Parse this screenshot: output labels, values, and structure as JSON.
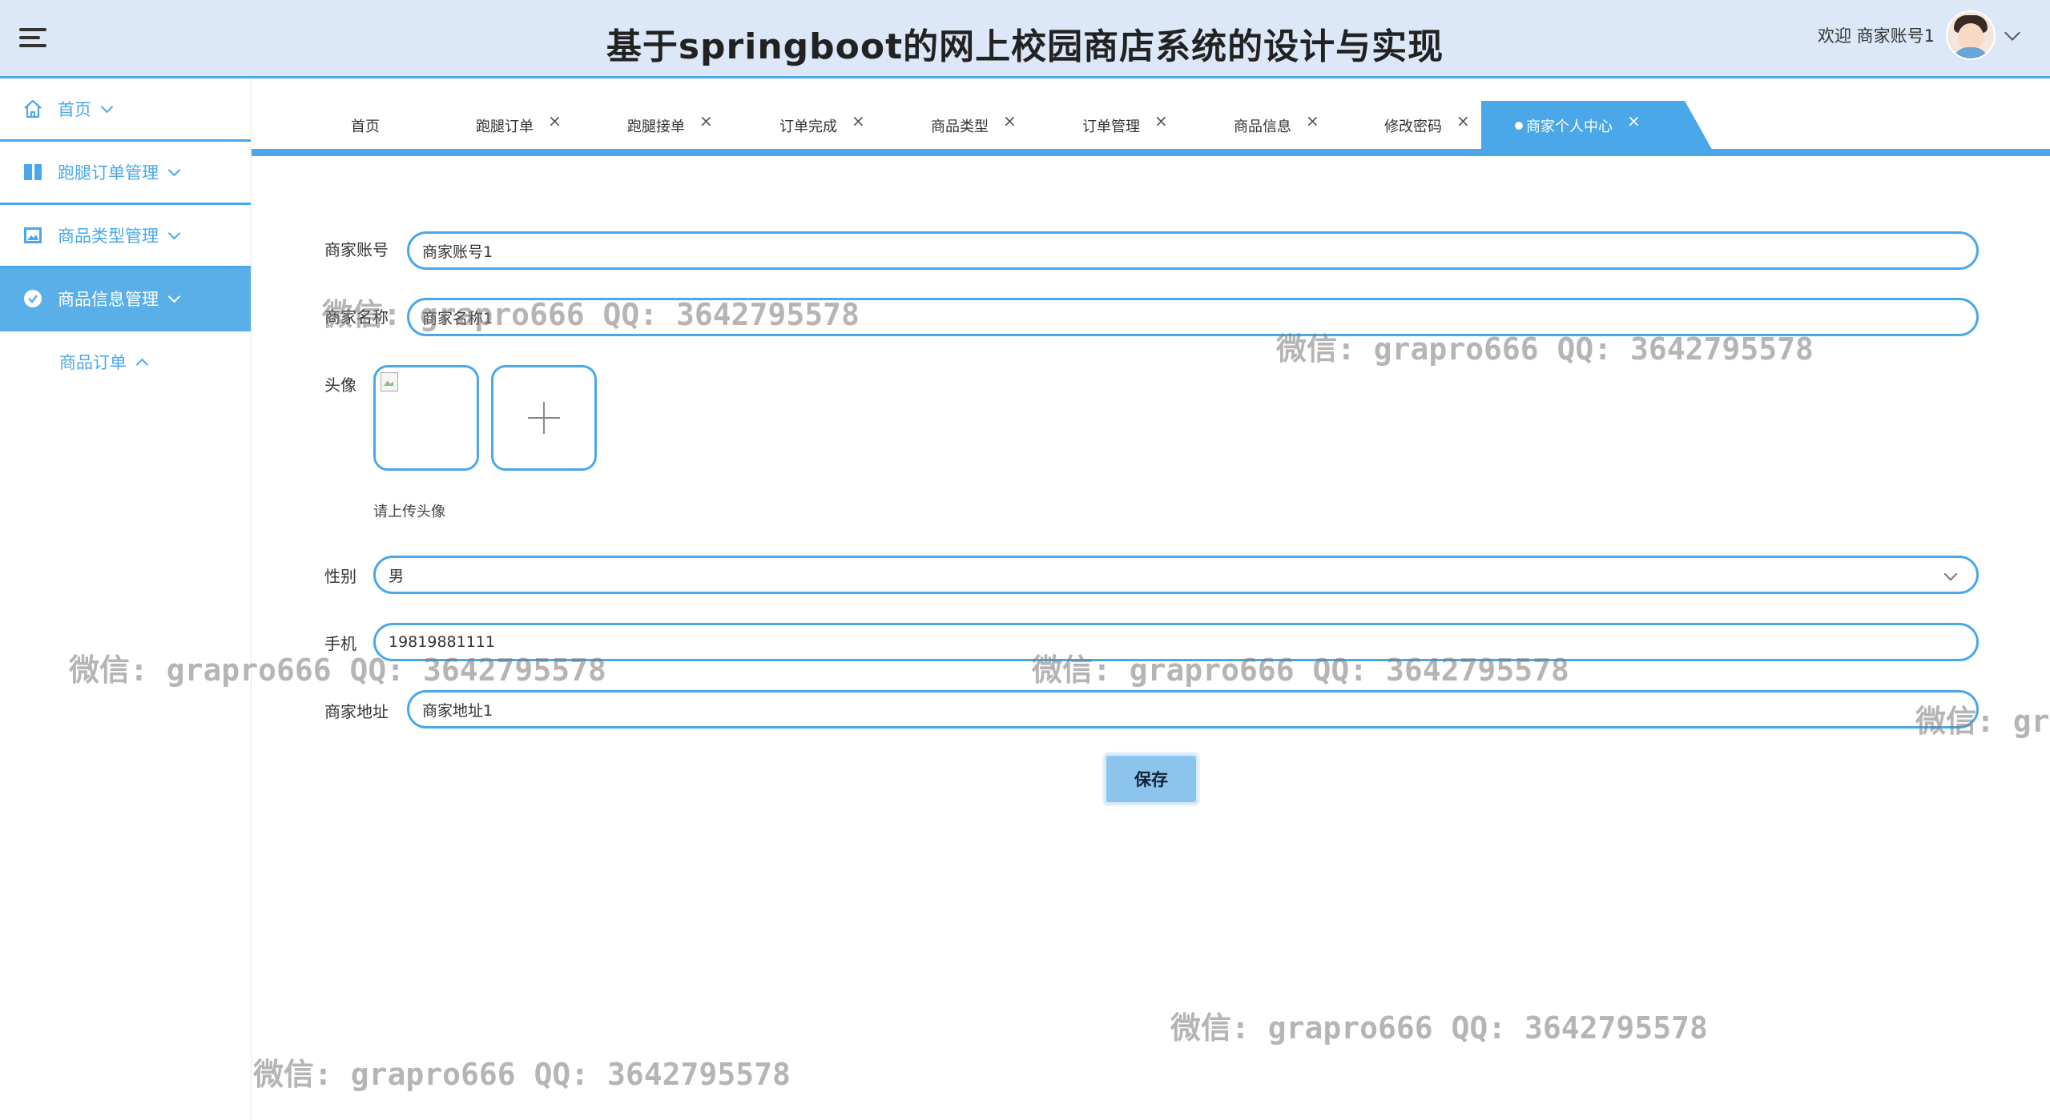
{
  "header": {
    "title": "基于springboot的网上校园商店系统的设计与实现",
    "welcome": "欢迎 商家账号1"
  },
  "sidebar": {
    "items": [
      {
        "label": "首页",
        "icon": "home-icon"
      },
      {
        "label": "跑腿订单管理",
        "icon": "document-icon"
      },
      {
        "label": "商品类型管理",
        "icon": "image-icon"
      },
      {
        "label": "商品信息管理",
        "icon": "check-circle-icon",
        "active": true
      }
    ],
    "sub_items": [
      {
        "label": "商品订单"
      }
    ]
  },
  "tabs": [
    {
      "label": "首页"
    },
    {
      "label": "跑腿订单",
      "close": "×"
    },
    {
      "label": "跑腿接单",
      "close": "×"
    },
    {
      "label": "订单完成",
      "close": "×"
    },
    {
      "label": "商品类型",
      "close": "×"
    },
    {
      "label": "订单管理",
      "close": "×"
    },
    {
      "label": "商品信息",
      "close": "×"
    },
    {
      "label": "修改密码",
      "close": "×"
    },
    {
      "label": "商家个人中心",
      "close": "×",
      "active": true
    }
  ],
  "form": {
    "account_label": "商家账号",
    "account_value": "商家账号1",
    "name_label": "商家名称",
    "name_value": "商家名称1",
    "avatar_label": "头像",
    "avatar_hint": "请上传头像",
    "gender_label": "性别",
    "gender_value": "男",
    "phone_label": "手机",
    "phone_value": "19819881111",
    "address_label": "商家地址",
    "address_value": "商家地址1",
    "save_label": "保存"
  },
  "watermarks": [
    "微信: grapro666 QQ: 3642795578",
    "微信: grapro666 QQ: 3642795578",
    "微信: grapro666 QQ: 3642795578",
    "微信: grapro666 QQ: 3642795578",
    "微信: gr",
    "微信: grapro666 QQ: 3642795578",
    "微信: grapro666 QQ: 3642795578"
  ],
  "colors": {
    "accent": "#4aa8e8",
    "header_bg": "#dce8f7",
    "active_sidebar": "#5aafe8"
  }
}
